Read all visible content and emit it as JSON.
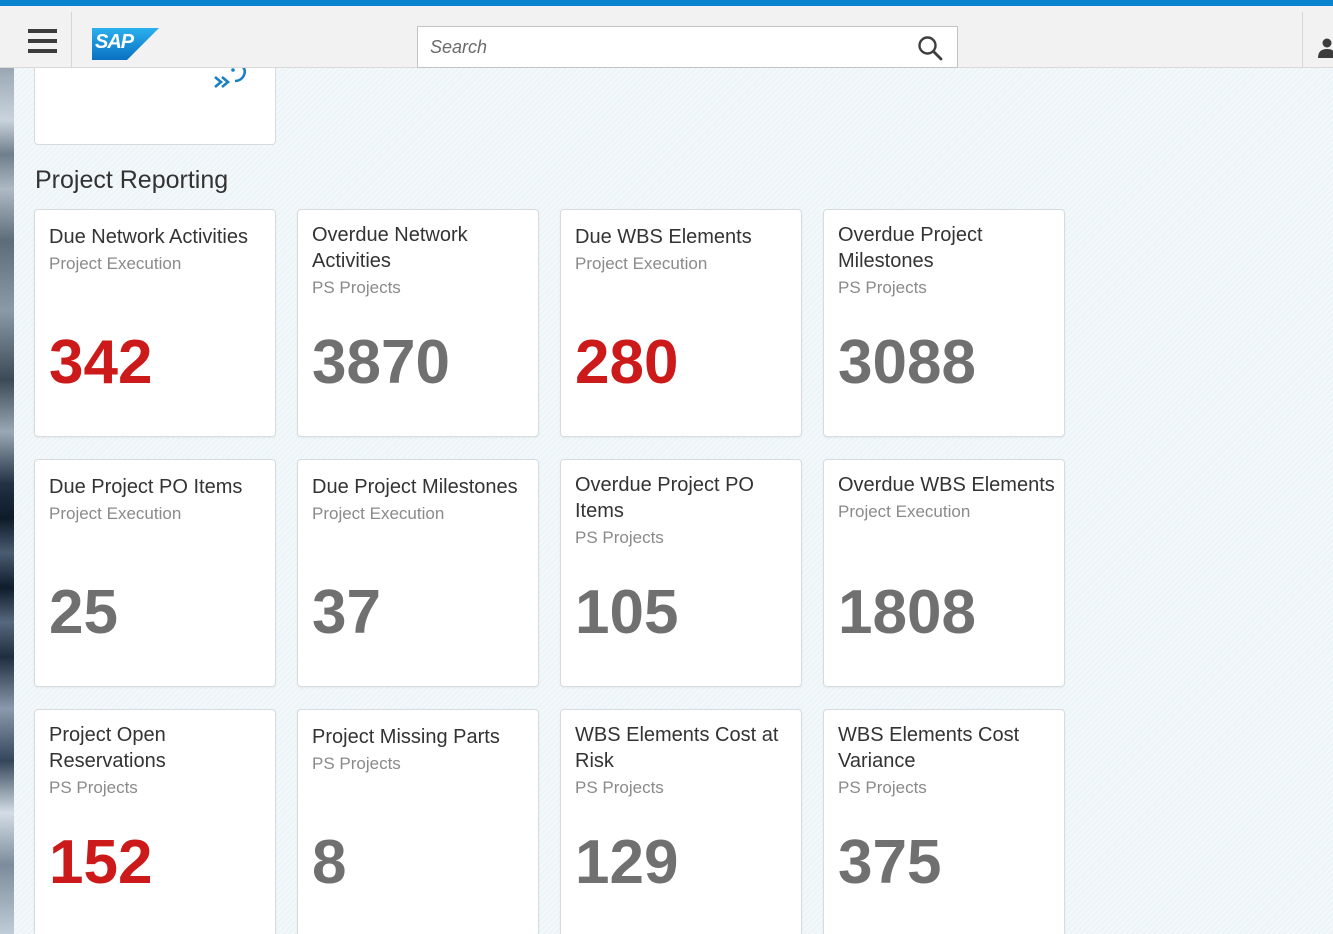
{
  "header": {
    "logo_text": "SAP",
    "search_placeholder": "Search",
    "accent_color": "#0a84ce"
  },
  "group": {
    "title": "Project Reporting"
  },
  "tiles": [
    {
      "title": "Due Network Activities",
      "subtitle": "Project Execution",
      "value": "342",
      "status": "critical"
    },
    {
      "title": "Overdue Network Activities",
      "subtitle": "PS Projects",
      "value": "3870",
      "status": "neutral"
    },
    {
      "title": "Due WBS Elements",
      "subtitle": "Project Execution",
      "value": "280",
      "status": "critical"
    },
    {
      "title": "Overdue Project Milestones",
      "subtitle": "PS Projects",
      "value": "3088",
      "status": "neutral"
    },
    {
      "title": "Due Project PO Items",
      "subtitle": "Project Execution",
      "value": "25",
      "status": "neutral"
    },
    {
      "title": "Due Project Milestones",
      "subtitle": "Project Execution",
      "value": "37",
      "status": "neutral"
    },
    {
      "title": "Overdue Project PO Items",
      "subtitle": "PS Projects",
      "value": "105",
      "status": "neutral"
    },
    {
      "title": "Overdue WBS Elements",
      "subtitle": "Project Execution",
      "value": "1808",
      "status": "neutral"
    },
    {
      "title": "Project Open Reservations",
      "subtitle": "PS Projects",
      "value": "152",
      "status": "critical"
    },
    {
      "title": "Project Missing Parts",
      "subtitle": "PS Projects",
      "value": "8",
      "status": "neutral"
    },
    {
      "title": "WBS Elements Cost at Risk",
      "subtitle": "PS Projects",
      "value": "129",
      "status": "neutral"
    },
    {
      "title": "WBS Elements Cost Variance",
      "subtitle": "PS Projects",
      "value": "375",
      "status": "neutral"
    }
  ],
  "colors": {
    "critical": "#cc1919",
    "neutral": "#707070"
  }
}
